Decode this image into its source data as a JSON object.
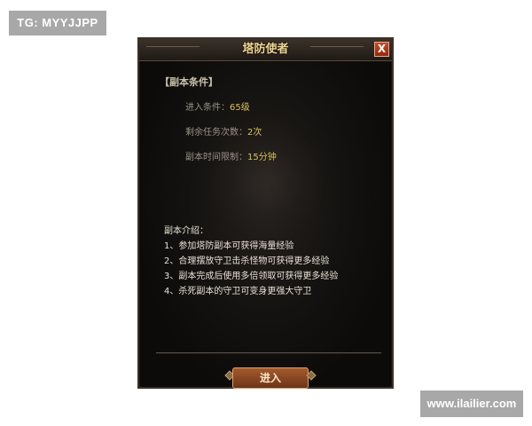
{
  "watermarks": {
    "top_left": "TG: MYYJJPP",
    "bottom_right": "www.ilailier.com"
  },
  "dialog": {
    "title": "塔防使者",
    "close_label": "X",
    "conditions": {
      "heading": "【副本条件】",
      "entry_level_label": "进入条件：",
      "entry_level_value": "65级",
      "remaining_runs_label": "剩余任务次数：",
      "remaining_runs_value": "2次",
      "time_limit_label": "副本时间限制：",
      "time_limit_value": "15分钟"
    },
    "intro": {
      "heading": "副本介绍：",
      "items": [
        "1、参加塔防副本可获得海量经验",
        "2、合理摆放守卫击杀怪物可获得更多经验",
        "3、副本完成后使用多倍领取可获得更多经验",
        "4、杀死副本的守卫可变身更强大守卫"
      ]
    },
    "enter_button_label": "进入"
  },
  "colors": {
    "title_gold": "#f0d590",
    "value_yellow": "#d8c060",
    "close_red": "#b83c20",
    "enter_brown": "#8e4824"
  }
}
